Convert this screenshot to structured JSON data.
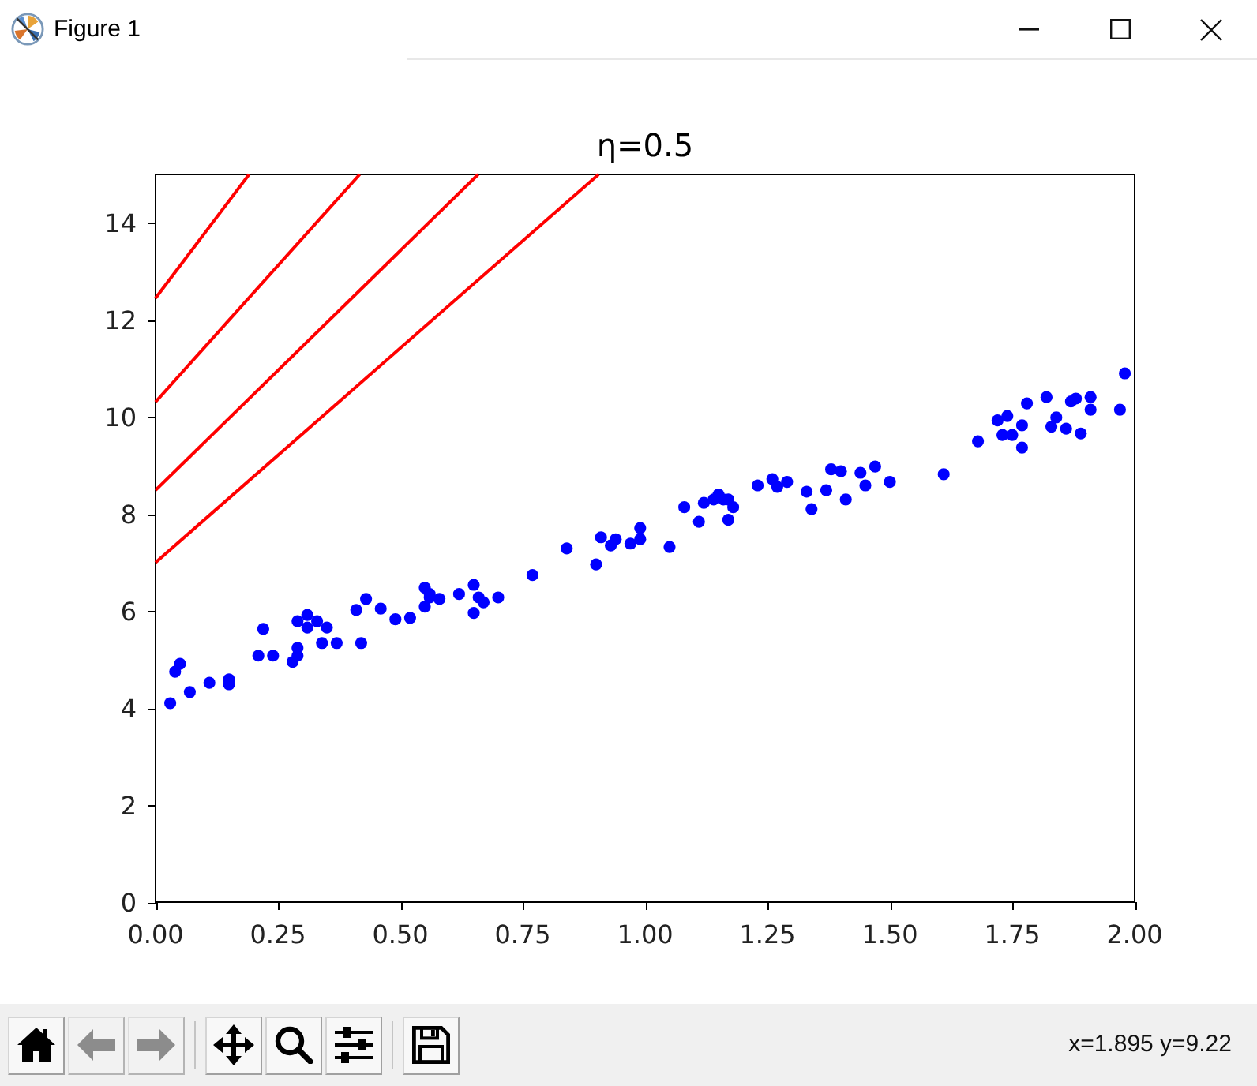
{
  "window": {
    "title": "Figure 1"
  },
  "figure": {
    "chart_data": {
      "type": "scatter",
      "title": "η=0.5",
      "xlim": [
        0,
        2
      ],
      "ylim": [
        0,
        15
      ],
      "xticks": [
        {
          "value": 0,
          "label": "0.00"
        },
        {
          "value": 0.25,
          "label": "0.25"
        },
        {
          "value": 0.5,
          "label": "0.50"
        },
        {
          "value": 0.75,
          "label": "0.75"
        },
        {
          "value": 1,
          "label": "1.00"
        },
        {
          "value": 1.25,
          "label": "1.25"
        },
        {
          "value": 1.5,
          "label": "1.50"
        },
        {
          "value": 1.75,
          "label": "1.75"
        },
        {
          "value": 2,
          "label": "2.00"
        }
      ],
      "yticks": [
        0,
        2,
        4,
        6,
        8,
        10,
        12,
        14
      ],
      "series": [
        {
          "type": "scatter",
          "color": "#0000ff",
          "x": [
            0.03,
            0.04,
            0.05,
            0.07,
            0.11,
            0.15,
            0.15,
            0.21,
            0.22,
            0.24,
            0.28,
            0.29,
            0.29,
            0.29,
            0.31,
            0.31,
            0.33,
            0.35,
            0.34,
            0.37,
            0.41,
            0.42,
            0.43,
            0.46,
            0.49,
            0.52,
            0.55,
            0.55,
            0.56,
            0.56,
            0.58,
            0.62,
            0.65,
            0.65,
            0.66,
            0.67,
            0.7,
            0.77,
            0.84,
            0.9,
            0.91,
            0.93,
            0.94,
            0.97,
            0.99,
            0.99,
            1.05,
            1.08,
            1.11,
            1.12,
            1.14,
            1.15,
            1.16,
            1.17,
            1.17,
            1.18,
            1.23,
            1.26,
            1.27,
            1.29,
            1.33,
            1.34,
            1.37,
            1.38,
            1.4,
            1.41,
            1.44,
            1.45,
            1.47,
            1.5,
            1.61,
            1.68,
            1.72,
            1.73,
            1.74,
            1.75,
            1.77,
            1.77,
            1.78,
            1.82,
            1.83,
            1.84,
            1.86,
            1.87,
            1.88,
            1.89,
            1.91,
            1.91,
            1.97,
            1.98
          ],
          "values": [
            4.1,
            4.75,
            4.91,
            4.33,
            4.52,
            4.49,
            4.59,
            5.08,
            5.63,
            5.08,
            4.95,
            5.08,
            5.24,
            5.79,
            5.66,
            5.92,
            5.79,
            5.66,
            5.34,
            5.34,
            6.02,
            5.34,
            6.25,
            6.05,
            5.83,
            5.86,
            6.09,
            6.48,
            6.35,
            6.28,
            6.25,
            6.35,
            6.54,
            5.96,
            6.28,
            6.18,
            6.28,
            6.74,
            7.29,
            6.96,
            7.52,
            7.35,
            7.48,
            7.39,
            7.71,
            7.48,
            7.32,
            8.14,
            7.84,
            8.23,
            8.3,
            8.4,
            8.3,
            7.88,
            8.3,
            8.14,
            8.59,
            8.72,
            8.56,
            8.66,
            8.46,
            8.1,
            8.49,
            8.92,
            8.88,
            8.3,
            8.85,
            8.59,
            8.98,
            8.66,
            8.82,
            9.5,
            9.93,
            9.63,
            10.02,
            9.63,
            9.37,
            9.83,
            10.28,
            10.41,
            9.8,
            9.99,
            9.76,
            10.32,
            10.38,
            9.66,
            10.15,
            10.41,
            10.15,
            10.9
          ]
        },
        {
          "type": "line",
          "color": "#ff0000",
          "x": [
            0,
            0.905
          ],
          "values": [
            7.0,
            15
          ]
        },
        {
          "type": "line",
          "color": "#ff0000",
          "x": [
            0,
            0.659
          ],
          "values": [
            8.49,
            15
          ]
        },
        {
          "type": "line",
          "color": "#ff0000",
          "x": [
            0,
            0.417
          ],
          "values": [
            10.31,
            15
          ]
        },
        {
          "type": "line",
          "color": "#ff0000",
          "x": [
            0,
            0.191
          ],
          "values": [
            12.45,
            15
          ]
        }
      ]
    }
  },
  "toolbar": {
    "button_groups": [
      [
        {
          "kind": "home",
          "disabled": false
        },
        {
          "kind": "back",
          "disabled": true
        },
        {
          "kind": "forward",
          "disabled": true
        }
      ],
      [
        {
          "kind": "pan",
          "disabled": false
        },
        {
          "kind": "zoom",
          "disabled": false
        },
        {
          "kind": "configure",
          "disabled": false
        }
      ],
      [
        {
          "kind": "save",
          "disabled": false
        }
      ]
    ],
    "coordinates": "x=1.895 y=9.22"
  }
}
